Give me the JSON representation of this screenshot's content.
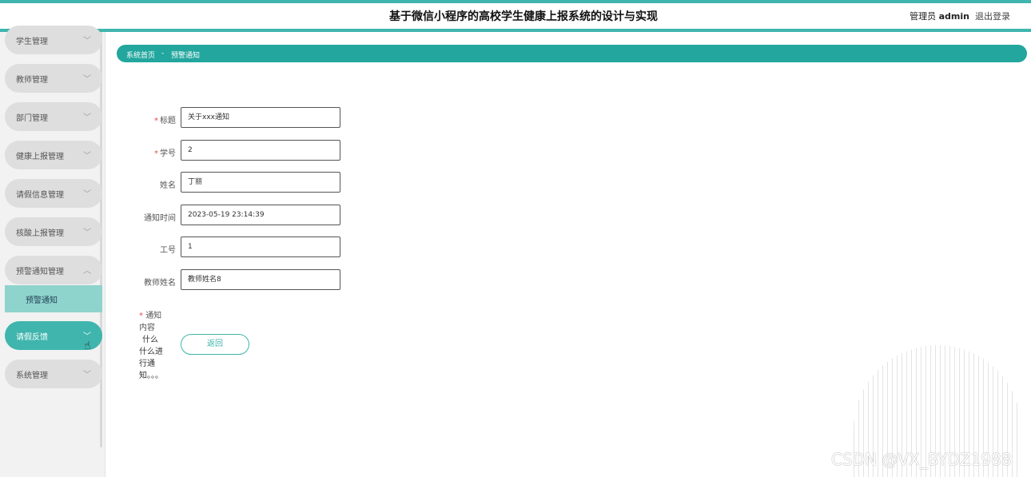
{
  "header": {
    "title": "基于微信小程序的高校学生健康上报系统的设计与实现",
    "user_prefix": "管理员",
    "user_name": "admin",
    "logout": "退出登录"
  },
  "sidebar": {
    "items": [
      {
        "label": "学生管理"
      },
      {
        "label": "教师管理"
      },
      {
        "label": "部门管理"
      },
      {
        "label": "健康上报管理"
      },
      {
        "label": "请假信息管理"
      },
      {
        "label": "核酸上报管理"
      },
      {
        "label": "预警通知管理"
      },
      {
        "label": "请假反馈"
      },
      {
        "label": "系统管理"
      }
    ],
    "submenu": {
      "label": "预警通知"
    }
  },
  "breadcrumb": {
    "home": "系统首页",
    "separator": "-",
    "current": "预警通知"
  },
  "form": {
    "fields": [
      {
        "label": "标题",
        "required": true,
        "value": "关于xxx通知"
      },
      {
        "label": "学号",
        "required": true,
        "value": "2"
      },
      {
        "label": "姓名",
        "required": false,
        "value": "丁丽"
      },
      {
        "label": "通知时间",
        "required": false,
        "value": "2023-05-19 23:14:39"
      },
      {
        "label": "工号",
        "required": false,
        "value": "1"
      },
      {
        "label": "教师姓名",
        "required": false,
        "value": "教师姓名8"
      }
    ],
    "content_label": "通知内容",
    "content_value": "什么什么进行通知。。。",
    "back_button": "返回"
  },
  "watermark": "CSDN @VX_BYDZ1988",
  "colors": {
    "accent": "#3fb5ad",
    "breadcrumb": "#22a69e",
    "required": "#e64a4a"
  }
}
